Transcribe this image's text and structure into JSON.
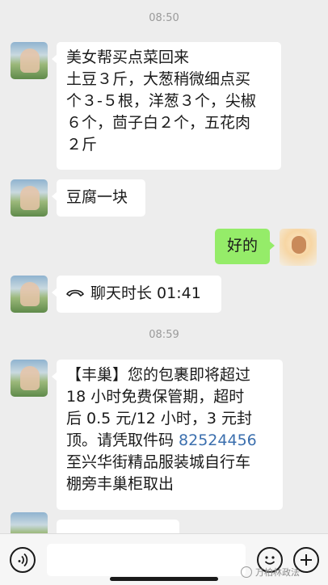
{
  "timestamps": [
    "08:50",
    "08:59"
  ],
  "messages": {
    "m1": {
      "lines": [
        "美女帮买点菜回来",
        "土豆３斤，大葱稍微细点买",
        "个３-５根，洋葱３个，尖椒",
        "６个，茴子白２个，五花肉",
        "２斤"
      ]
    },
    "m2": {
      "text": "豆腐一块"
    },
    "m3": {
      "text": "好的"
    },
    "m4": {
      "icon": "phone-call-icon",
      "text": "聊天时长 01:41"
    },
    "m5": {
      "lines": [
        "【丰巢】您的包裹即将超过",
        "18 小时免费保管期，超时",
        "后 0.5 元/12 小时，3 元封"
      ],
      "line4_prefix": "顶。请凭取件码 ",
      "pickup_code": "82524456",
      "lines_after": [
        "至兴华街精品服装城自行车",
        "棚旁丰巢柜取出"
      ]
    }
  },
  "input_bar": {
    "voice_icon": "voice-icon",
    "emoji_icon": "emoji-icon",
    "plus_icon": "plus-icon",
    "message_value": ""
  },
  "watermark": {
    "text": "万柏林政法"
  },
  "colors": {
    "background": "#ededed",
    "incoming": "#ffffff",
    "outgoing": "#95ec69",
    "link": "#3b6fae"
  }
}
